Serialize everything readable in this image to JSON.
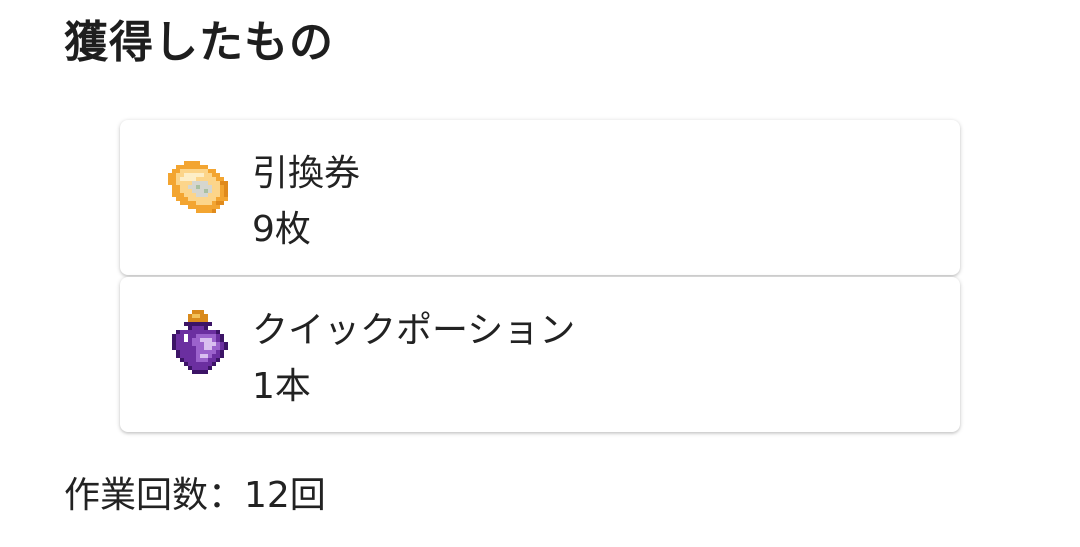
{
  "section": {
    "title": "獲得したもの"
  },
  "items": [
    {
      "name": "引換券",
      "quantity": "9枚",
      "icon": "ticket-icon",
      "colors": {
        "base": "#f6b13c",
        "light": "#fde7b3",
        "center": "#cfd3cf"
      }
    },
    {
      "name": "クイックポーション",
      "quantity": "1本",
      "icon": "potion-icon",
      "colors": {
        "glass": "#6b2fa0",
        "dark": "#3c1466",
        "light": "#c9a6e8",
        "cork": "#d98a1c"
      }
    }
  ],
  "footer": {
    "label": "作業回数：12回"
  }
}
